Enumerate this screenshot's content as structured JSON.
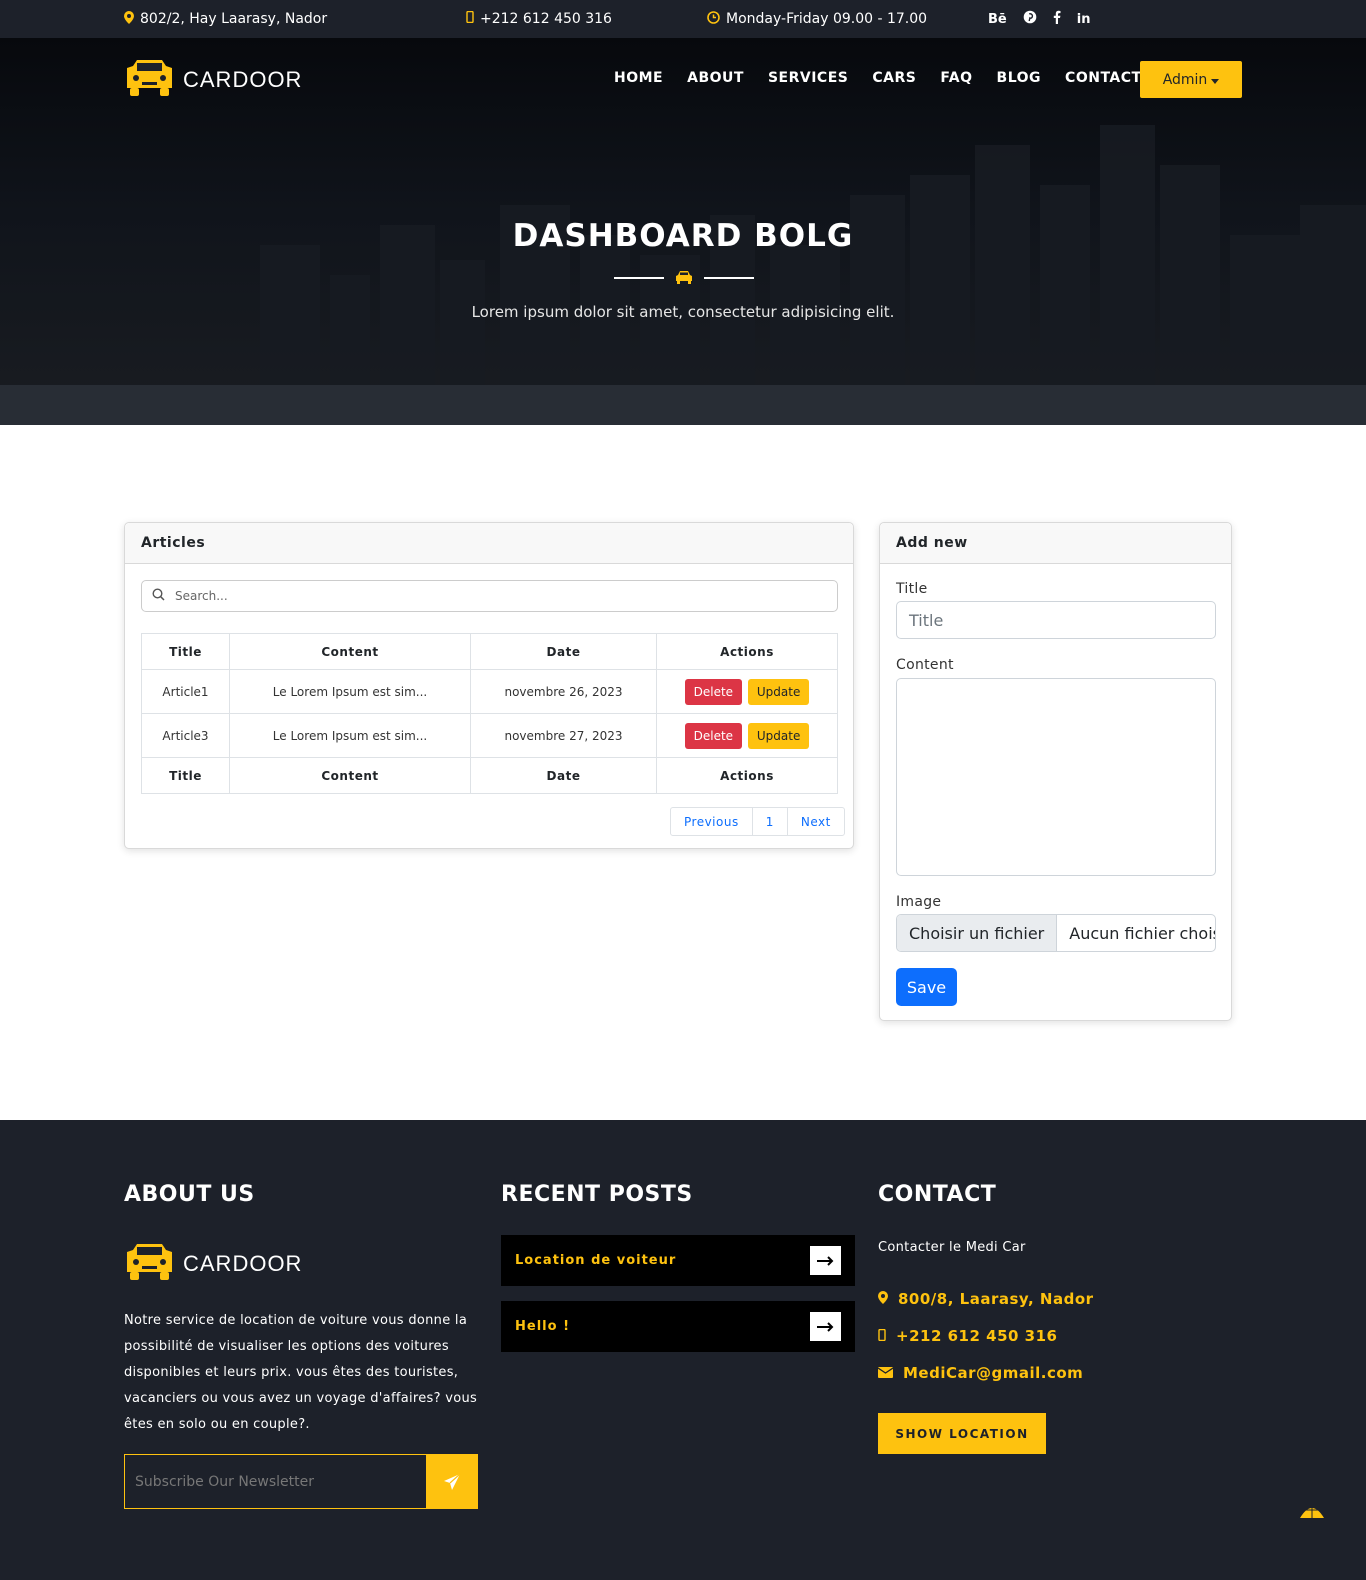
{
  "topbar": {
    "address": "802/2, Hay Laarasy, Nador",
    "phone": "+212 612 450 316",
    "hours": "Monday-Friday 09.00 - 17.00",
    "social": [
      "Bē",
      "pinterest-icon",
      "facebook-icon",
      "linkedin-icon"
    ],
    "social_behance_label": "Bē",
    "social_linkedin_label": "in"
  },
  "brand": {
    "name": "CARDOOR",
    "accent": "#fec20f",
    "dark": "#1d212a"
  },
  "nav": {
    "items": [
      "HOME",
      "ABOUT",
      "SERVICES",
      "CARS",
      "FAQ",
      "BLOG",
      "CONTACT"
    ],
    "admin_label": "Admin"
  },
  "hero": {
    "title": "DASHBOARD BOLG",
    "subtitle": "Lorem ipsum dolor sit amet, consectetur adipisicing elit."
  },
  "articles": {
    "header": "Articles",
    "search_placeholder": "Search...",
    "columns": [
      "Title",
      "Content",
      "Date",
      "Actions"
    ],
    "rows": [
      {
        "title": "Article1",
        "content": "Le Lorem Ipsum est sim...",
        "date": "novembre 26, 2023"
      },
      {
        "title": "Article3",
        "content": "Le Lorem Ipsum est sim...",
        "date": "novembre 27, 2023"
      }
    ],
    "delete_label": "Delete",
    "update_label": "Update",
    "pagination": {
      "previous": "Previous",
      "page": "1",
      "next": "Next"
    }
  },
  "add_new": {
    "header": "Add new",
    "title_label": "Title",
    "title_placeholder": "Title",
    "content_label": "Content",
    "image_label": "Image",
    "file_button": "Choisir un fichier",
    "file_status": "Aucun fichier choisi",
    "save_label": "Save"
  },
  "footer": {
    "about_heading": "ABOUT US",
    "about_text": "Notre service de location de voiture vous donne la possibilité de visualiser les options des voitures disponibles et leurs prix. vous êtes des touristes, vacanciers ou vous avez un voyage d'affaires? vous êtes en solo ou en couple?.",
    "newsletter_placeholder": "Subscribe Our Newsletter",
    "recent_heading": "RECENT POSTS",
    "posts": [
      "Location de voiteur",
      "Hello !"
    ],
    "contact_heading": "CONTACT",
    "contact_intro": "Contacter le Medi Car",
    "contact_address": "800/8, Laarasy, Nador",
    "contact_phone": "+212 612 450 316",
    "contact_email": "MediCar@gmail.com",
    "show_location_label": "SHOW LOCATION"
  }
}
